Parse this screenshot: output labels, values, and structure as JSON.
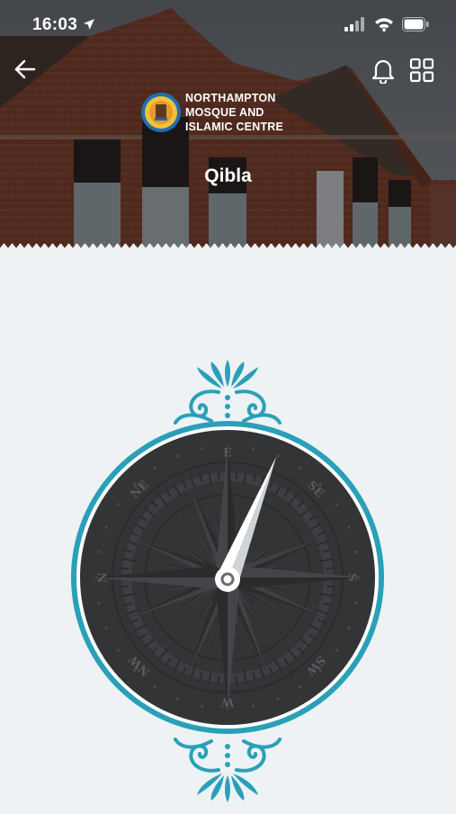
{
  "status": {
    "time": "16:03"
  },
  "header": {
    "logo_lines": [
      "Northampton",
      "Mosque and",
      "Islamic Centre"
    ],
    "title": "Qibla"
  },
  "compass": {
    "labels": [
      "E",
      "SE",
      "S",
      "SW",
      "W",
      "NW",
      "N",
      "NE"
    ],
    "accent_color": "#2aa0b8",
    "dial_color": "#333436",
    "needle_color": "#ffffff"
  },
  "icons": {
    "back": "arrow-left-icon",
    "notifications": "bell-icon",
    "menu": "grid-icon",
    "location": "location-arrow-icon",
    "signal": "cellular-signal-icon",
    "wifi": "wifi-icon",
    "battery": "battery-icon"
  }
}
